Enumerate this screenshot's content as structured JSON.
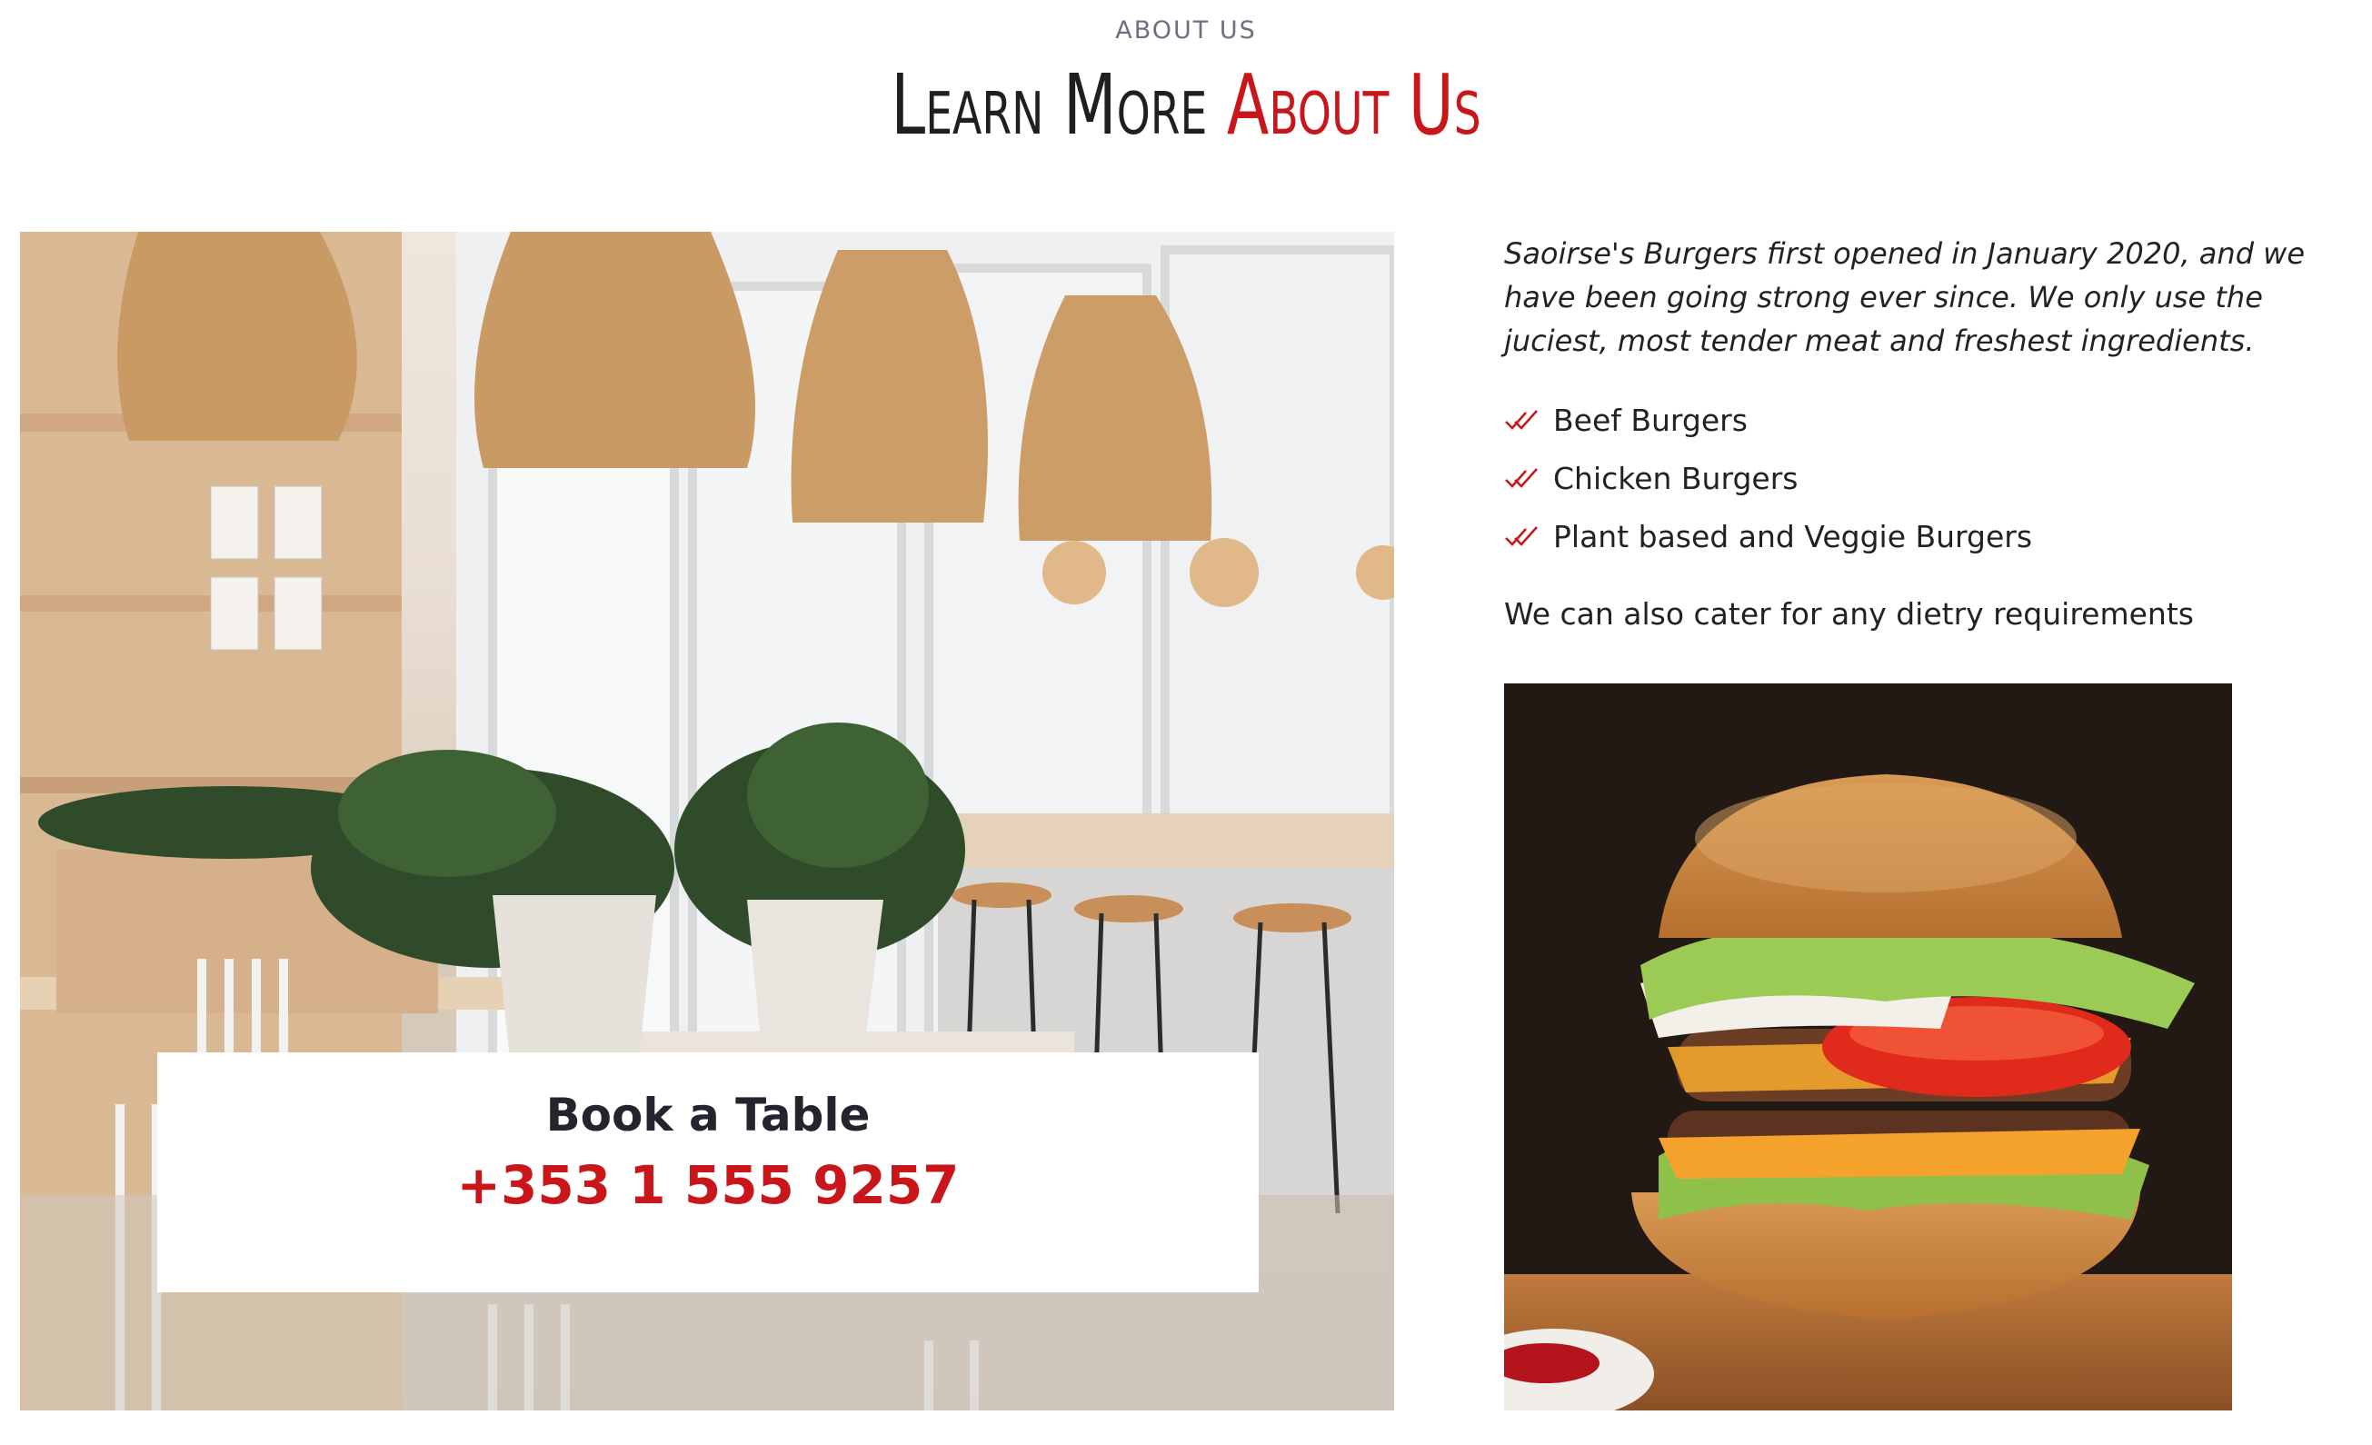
{
  "section": {
    "eyebrow": "ABOUT US",
    "title_main": "Learn More ",
    "title_accent": "About Us"
  },
  "booking": {
    "title": "Book a Table",
    "phone": "+353 1 555 9257"
  },
  "about": {
    "intro": "Saoirse's Burgers first opened in January 2020, and we have been going strong ever since. We only use the juciest, most tender meat and freshest ingredients.",
    "features": [
      "Beef Burgers",
      "Chicken Burgers",
      "Plant based and Veggie Burgers"
    ],
    "note": "We can also cater for any dietry requirements"
  },
  "colors": {
    "accent": "#c8161b",
    "text": "#222222",
    "muted": "#6f6f80"
  },
  "images": {
    "restaurant": "restaurant-interior-photo",
    "burger": "burger-photo"
  }
}
